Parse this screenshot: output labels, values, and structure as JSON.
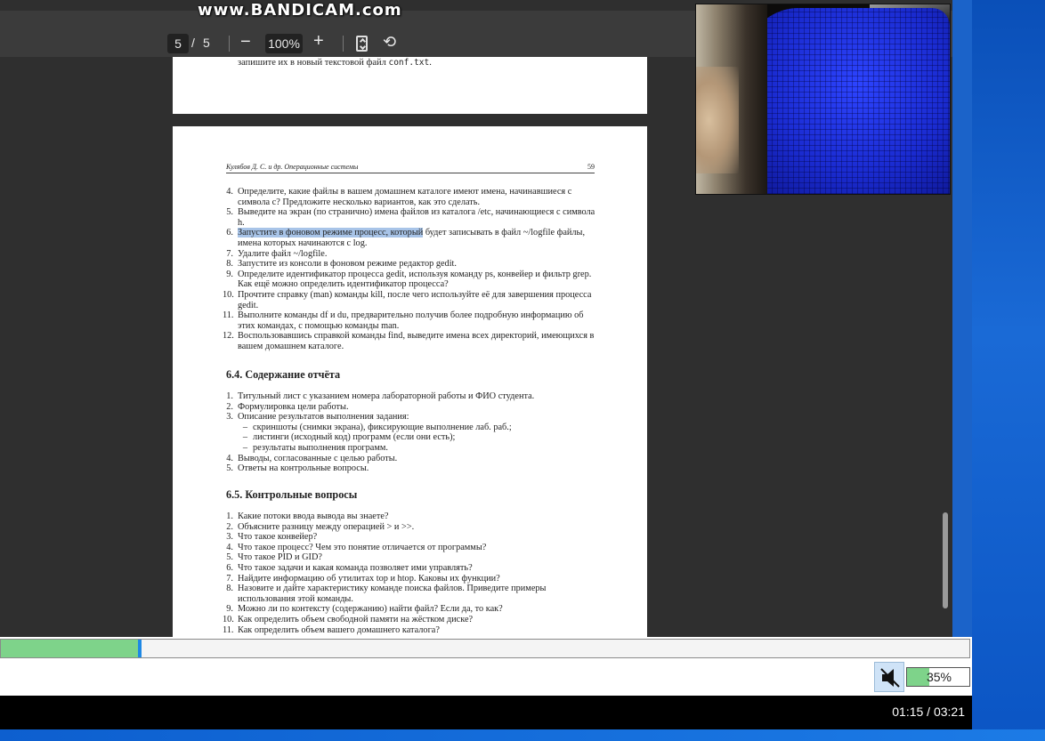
{
  "watermark": "www.BANDICAM.com",
  "toolbar": {
    "page_current": "5",
    "page_separator": "/",
    "page_total": "5",
    "zoom_out": "−",
    "zoom_level": "100%",
    "zoom_in": "+",
    "rotate_glyph": "⟲"
  },
  "prev_page": {
    "line_text": "запишите их в новый текстовой файл ",
    "line_code": "conf.txt",
    "line_end": "."
  },
  "page": {
    "running_head": "Кулябов Д. С. и др. Операционные системы",
    "page_number": "59",
    "tasks": [
      {
        "n": "4.",
        "text": "Определите, какие файлы в вашем домашнем каталоге имеют имена, начинавшиеся с символа c? Предложите несколько вариантов, как это сделать."
      },
      {
        "n": "5.",
        "text": "Выведите на экран (по странично) имена файлов из каталога /etc, начинающиеся с символа h."
      },
      {
        "n": "6.",
        "hl": "Запустите в фоновом режиме процесс, который",
        "text": " будет записывать в файл ~/logfile файлы, имена которых начинаются с log."
      },
      {
        "n": "7.",
        "text": "Удалите файл ~/logfile."
      },
      {
        "n": "8.",
        "text": "Запустите из консоли в фоновом режиме редактор gedit."
      },
      {
        "n": "9.",
        "text": "Определите идентификатор процесса gedit, используя команду ps, конвейер и фильтр grep. Как ещё можно определить идентификатор процесса?"
      },
      {
        "n": "10.",
        "text": "Прочтите справку (man) команды kill, после чего используйте её для завершения процесса gedit."
      },
      {
        "n": "11.",
        "text": "Выполните команды df и du, предварительно получив более подробную информацию об этих командах, с помощью команды man."
      },
      {
        "n": "12.",
        "text": "Воспользовавшись справкой команды find, выведите имена всех директорий, имеющихся в вашем домашнем каталоге."
      }
    ],
    "report_heading": "6.4.   Содержание отчёта",
    "report_items": [
      {
        "n": "1.",
        "text": "Титульный лист с указанием номера лабораторной работы и ФИО студента."
      },
      {
        "n": "2.",
        "text": "Формулировка цели работы."
      },
      {
        "n": "3.",
        "text": "Описание результатов выполнения задания:"
      },
      {
        "n": "–",
        "text": "скриншоты (снимки экрана), фиксирующие выполнение лаб. раб.;",
        "sub": true
      },
      {
        "n": "–",
        "text": "листинги (исходный код) программ (если они есть);",
        "sub": true
      },
      {
        "n": "–",
        "text": "результаты выполнения программ.",
        "sub": true
      },
      {
        "n": "4.",
        "text": "Выводы, согласованные с целью работы."
      },
      {
        "n": "5.",
        "text": "Ответы на контрольные вопросы."
      }
    ],
    "questions_heading": "6.5.   Контрольные вопросы",
    "questions": [
      {
        "n": "1.",
        "text": "Какие потоки ввода вывода вы знаете?"
      },
      {
        "n": "2.",
        "text": "Объясните разницу между операцией > и >>."
      },
      {
        "n": "3.",
        "text": "Что такое конвейер?"
      },
      {
        "n": "4.",
        "text": "Что такое процесс? Чем это понятие отличается от программы?"
      },
      {
        "n": "5.",
        "text": "Что такое PID и GID?"
      },
      {
        "n": "6.",
        "text": "Что такое задачи и какая команда позволяет ими управлять?"
      },
      {
        "n": "7.",
        "text": "Найдите информацию об утилитах top и htop. Каковы их функции?"
      },
      {
        "n": "8.",
        "text": "Назовите и дайте характеристику команде поиска файлов. Приведите примеры использования этой команды."
      },
      {
        "n": "9.",
        "text": "Можно ли по контексту (содержанию) найти файл? Если да, то как?"
      },
      {
        "n": "10.",
        "text": "Как определить объем свободной памяти на жёстком диске?"
      },
      {
        "n": "11.",
        "text": "Как определить объем вашего домашнего каталога?"
      }
    ]
  },
  "player": {
    "progress_fraction": 0.142,
    "volume_fraction": 0.35,
    "volume_label": "35%",
    "time": "01:15 / 03:21"
  },
  "colors": {
    "progress_fill": "#7ed38a",
    "progress_cursor": "#1e88e5",
    "text_highlight": "#a8c4e8"
  }
}
